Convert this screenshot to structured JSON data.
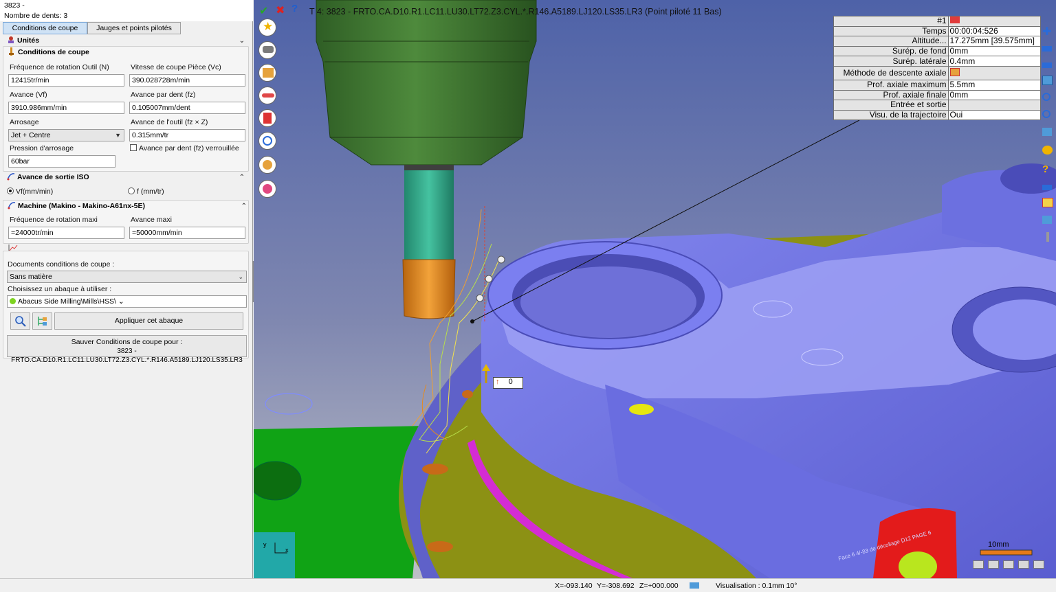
{
  "header": {
    "tool_name": "3823 - FRTO.CA.D10.R1.LC11.LU30.LT72.Z3.CYL.*.R146.A5189.LJ120.LS35.LR3",
    "teeth": "Nombre de dents: 3"
  },
  "tabs": [
    {
      "label": "Conditions de coupe",
      "active": true
    },
    {
      "label": "Jauges et points pilotés",
      "active": false
    }
  ],
  "sections": {
    "units": "Unités",
    "cutting_conditions": "Conditions de coupe",
    "iso_feed": "Avance de sortie ISO",
    "machine": "Machine (Makino - Makino-A61nx-5E)"
  },
  "fields": {
    "spindle_label": "Fréquence de rotation Outil (N)",
    "spindle_value": "12415tr/min",
    "vc_label": "Vitesse de coupe Pièce (Vc)",
    "vc_value": "390.028728m/min",
    "vf_label": "Avance (Vf)",
    "vf_value": "3910.986mm/min",
    "fz_label": "Avance par dent (fz)",
    "fz_value": "0.105007mm/dent",
    "coolant_label": "Arrosage",
    "coolant_value": "Jet + Centre",
    "tool_feed_label": "Avance de l'outil (fz × Z)",
    "tool_feed_value": "0.315mm/tr",
    "fz_locked_label": "Avance par dent (fz) verrouillée",
    "pressure_label": "Pression d'arrosage",
    "pressure_value": "60bar",
    "radio_vf": "Vf(mm/min)",
    "radio_f": "f (mm/tr)",
    "max_rot_label": "Fréquence de rotation maxi",
    "max_rot_value": "=24000tr/min",
    "max_feed_label": "Avance maxi",
    "max_feed_value": "=50000mm/min",
    "docs_label": "Documents conditions de coupe :",
    "docs_value": "Sans matière",
    "abacus_label": "Choisissez un abaque à utiliser :",
    "abacus_value": "Abacus Side Milling\\Mills\\HSS\\",
    "apply_button": "Appliquer cet abaque",
    "save_line1": "Sauver Conditions de coupe pour :",
    "save_line2": "3823 - FRTO.CA.D10.R1.LC11.LU30.LT72.Z3.CYL.*.R146.A5189.LJ120.LS35.LR3"
  },
  "viewport": {
    "title": "T 4: 3823 - FRTO.CA.D10.R1.LC11.LU30.LT72.Z3.CYL.*.R146.A5189.LJ120.LS35.LR3 (Point piloté 11 Bas)",
    "info_header": "#1",
    "info_rows": [
      {
        "key": "Temps",
        "value": "00:00:04:526"
      },
      {
        "key": "Altitude...",
        "value": "17.275mm [39.575mm]"
      },
      {
        "key": "Surép. de fond",
        "value": "0mm"
      },
      {
        "key": "Surép. latérale",
        "value": "0.4mm"
      },
      {
        "key": "Méthode de descente axiale",
        "value": ""
      },
      {
        "key": "Prof. axiale maximum",
        "value": "5.5mm"
      },
      {
        "key": "Prof. axiale finale",
        "value": "0mm"
      },
      {
        "key": "Entrée et sortie",
        "value": ""
      },
      {
        "key": "Visu. de la trajectoire",
        "value": "Oui"
      }
    ],
    "marker_value": "0",
    "scale_label": "10mm",
    "engraving": "Face 6 4/-83 de décollage D12 PAGE 6"
  },
  "status": {
    "x": "X=-093.140",
    "y": "Y=-308.692",
    "z": "Z=+000.000",
    "visu": "Visualisation : 0.1mm 10°"
  },
  "colors": {
    "part": "#6f72e6",
    "fixture": "#8a8f12",
    "holder": "#3f7a32",
    "shank": "#2fa386",
    "cutter": "#e48a1f",
    "sky_top": "#5a6fb0",
    "sky_bottom": "#b9bcc8"
  }
}
